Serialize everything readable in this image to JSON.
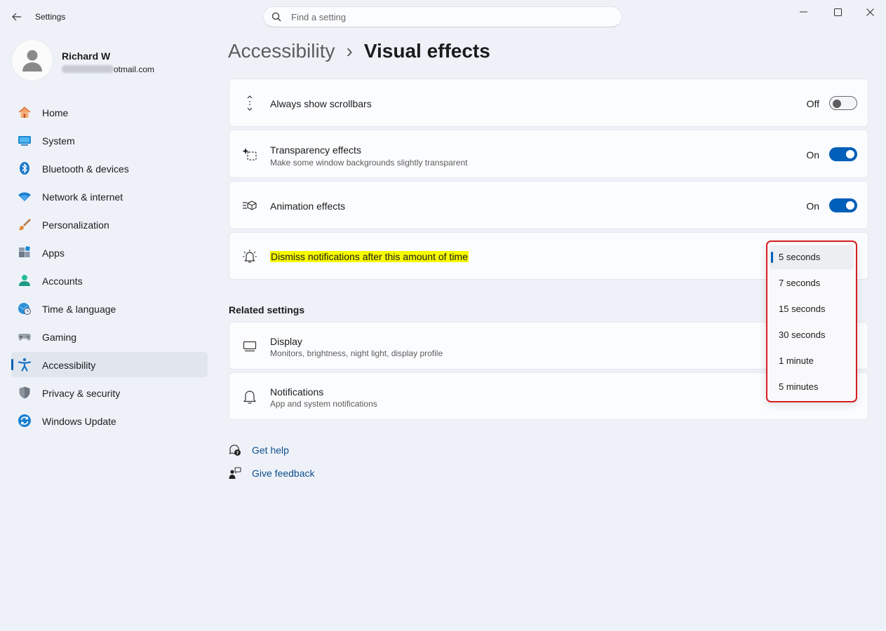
{
  "window": {
    "title": "Settings",
    "search_placeholder": "Find a setting"
  },
  "profile": {
    "name": "Richard W",
    "email_visible": "otmail.com"
  },
  "sidebar": {
    "items": [
      {
        "label": "Home",
        "icon": "home-icon",
        "active": false
      },
      {
        "label": "System",
        "icon": "system-icon",
        "active": false
      },
      {
        "label": "Bluetooth & devices",
        "icon": "bluetooth-icon",
        "active": false
      },
      {
        "label": "Network & internet",
        "icon": "wifi-icon",
        "active": false
      },
      {
        "label": "Personalization",
        "icon": "brush-icon",
        "active": false
      },
      {
        "label": "Apps",
        "icon": "apps-icon",
        "active": false
      },
      {
        "label": "Accounts",
        "icon": "accounts-icon",
        "active": false
      },
      {
        "label": "Time & language",
        "icon": "globe-clock-icon",
        "active": false
      },
      {
        "label": "Gaming",
        "icon": "gamepad-icon",
        "active": false
      },
      {
        "label": "Accessibility",
        "icon": "accessibility-icon",
        "active": true
      },
      {
        "label": "Privacy & security",
        "icon": "shield-icon",
        "active": false
      },
      {
        "label": "Windows Update",
        "icon": "update-icon",
        "active": false
      }
    ]
  },
  "breadcrumb": {
    "parent": "Accessibility",
    "separator": "›",
    "current": "Visual effects"
  },
  "settings": {
    "scrollbars": {
      "title": "Always show scrollbars",
      "state": "Off"
    },
    "transparency": {
      "title": "Transparency effects",
      "subtitle": "Make some window backgrounds slightly transparent",
      "state": "On"
    },
    "animation": {
      "title": "Animation effects",
      "state": "On"
    },
    "dismiss": {
      "title": "Dismiss notifications after this amount of time"
    }
  },
  "dropdown": {
    "selected_index": 0,
    "options": [
      "5 seconds",
      "7 seconds",
      "15 seconds",
      "30 seconds",
      "1 minute",
      "5 minutes"
    ]
  },
  "related": {
    "header": "Related settings",
    "display": {
      "title": "Display",
      "subtitle": "Monitors, brightness, night light, display profile"
    },
    "notifications": {
      "title": "Notifications",
      "subtitle": "App and system notifications"
    }
  },
  "help": {
    "get_help": "Get help",
    "give_feedback": "Give feedback"
  },
  "colors": {
    "accent": "#005fb8",
    "highlight": "#f6fa00",
    "annotation": "#d81e1e"
  }
}
